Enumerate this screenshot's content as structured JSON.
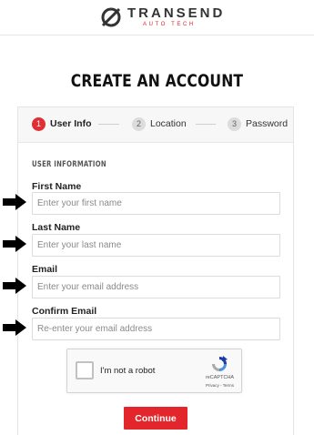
{
  "brand": {
    "name": "TRANSEND",
    "tagline": "AUTO TECH"
  },
  "colors": {
    "accent": "#e3262b",
    "step_active": "#e03033",
    "step_idle": "#dcdcdc"
  },
  "page": {
    "title": "CREATE AN ACCOUNT"
  },
  "steps": [
    {
      "number": "1",
      "label": "User Info",
      "state": "active"
    },
    {
      "number": "2",
      "label": "Location",
      "state": "idle"
    },
    {
      "number": "3",
      "label": "Password",
      "state": "idle"
    }
  ],
  "form": {
    "section_heading": "USER INFORMATION",
    "fields": [
      {
        "label": "First Name",
        "placeholder": "Enter your first name",
        "value": ""
      },
      {
        "label": "Last Name",
        "placeholder": "Enter your last name",
        "value": ""
      },
      {
        "label": "Email",
        "placeholder": "Enter your email address",
        "value": ""
      },
      {
        "label": "Confirm Email",
        "placeholder": "Re-enter your email address",
        "value": ""
      }
    ]
  },
  "captcha": {
    "label": "I'm not a robot",
    "brand": "reCAPTCHA",
    "links": "Privacy - Terms",
    "checked": false
  },
  "actions": {
    "continue_label": "Continue"
  },
  "icons": {
    "logo_mark": "slashed-circle-icon",
    "pointer": "right-arrow-icon",
    "captcha_logo": "recaptcha-icon"
  }
}
